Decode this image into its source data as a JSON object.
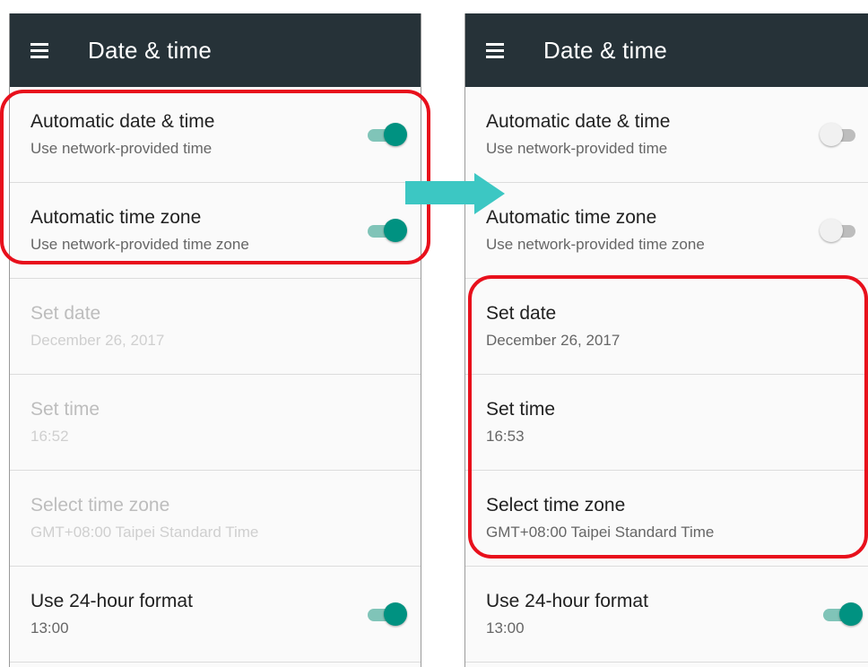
{
  "colors": {
    "appbar": "#263238",
    "accent": "#009281",
    "highlight": "#e8101c",
    "arrow": "#3cc7c3"
  },
  "icons": {
    "menu": "hamburger-menu-icon",
    "arrow": "right-arrow-icon"
  },
  "left": {
    "title": "Date & time",
    "auto_datetime": {
      "title": "Automatic date & time",
      "summary": "Use network-provided time",
      "enabled": true
    },
    "auto_timezone": {
      "title": "Automatic time zone",
      "summary": "Use network-provided time zone",
      "enabled": true
    },
    "set_date": {
      "title": "Set date",
      "summary": "December 26, 2017"
    },
    "set_time": {
      "title": "Set time",
      "summary": "16:52"
    },
    "select_timezone": {
      "title": "Select time zone",
      "summary": "GMT+08:00 Taipei Standard Time"
    },
    "use_24h": {
      "title": "Use 24-hour format",
      "summary": "13:00",
      "enabled": true
    }
  },
  "right": {
    "title": "Date & time",
    "auto_datetime": {
      "title": "Automatic date & time",
      "summary": "Use network-provided time",
      "enabled": false
    },
    "auto_timezone": {
      "title": "Automatic time zone",
      "summary": "Use network-provided time zone",
      "enabled": false
    },
    "set_date": {
      "title": "Set date",
      "summary": "December 26, 2017"
    },
    "set_time": {
      "title": "Set time",
      "summary": "16:53"
    },
    "select_timezone": {
      "title": "Select time zone",
      "summary": "GMT+08:00 Taipei Standard Time"
    },
    "use_24h": {
      "title": "Use 24-hour format",
      "summary": "13:00",
      "enabled": true
    }
  }
}
